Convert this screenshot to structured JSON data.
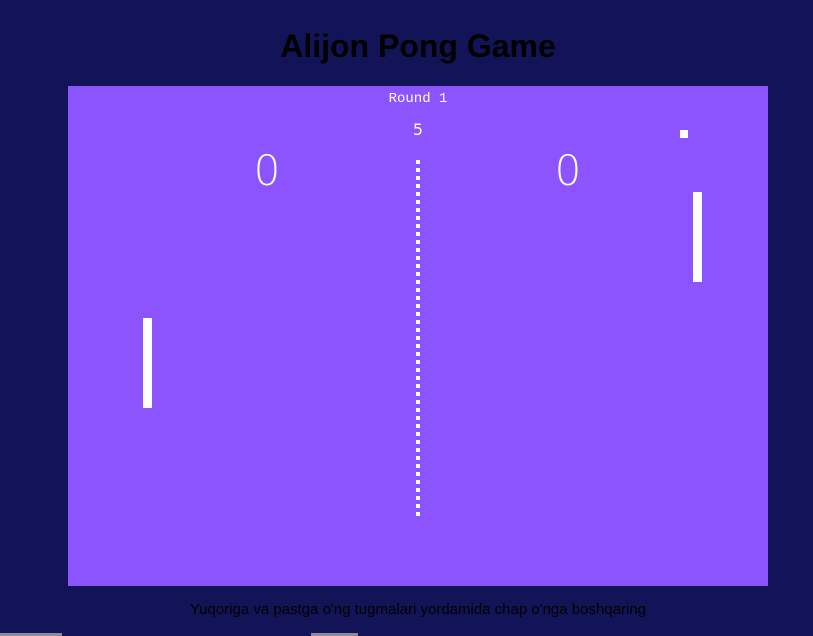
{
  "page": {
    "title": "Alijon Pong Game",
    "instructions": "Yuqoriga va pastga o'ng tugmalari yordamida chap o'nga boshqaring"
  },
  "game": {
    "round_label": "Round 1",
    "timer": "5",
    "score_left": "0",
    "score_right": "0"
  },
  "colors": {
    "page_background": "#121457",
    "court_background": "#8c54ff",
    "foreground": "#ffffff"
  }
}
